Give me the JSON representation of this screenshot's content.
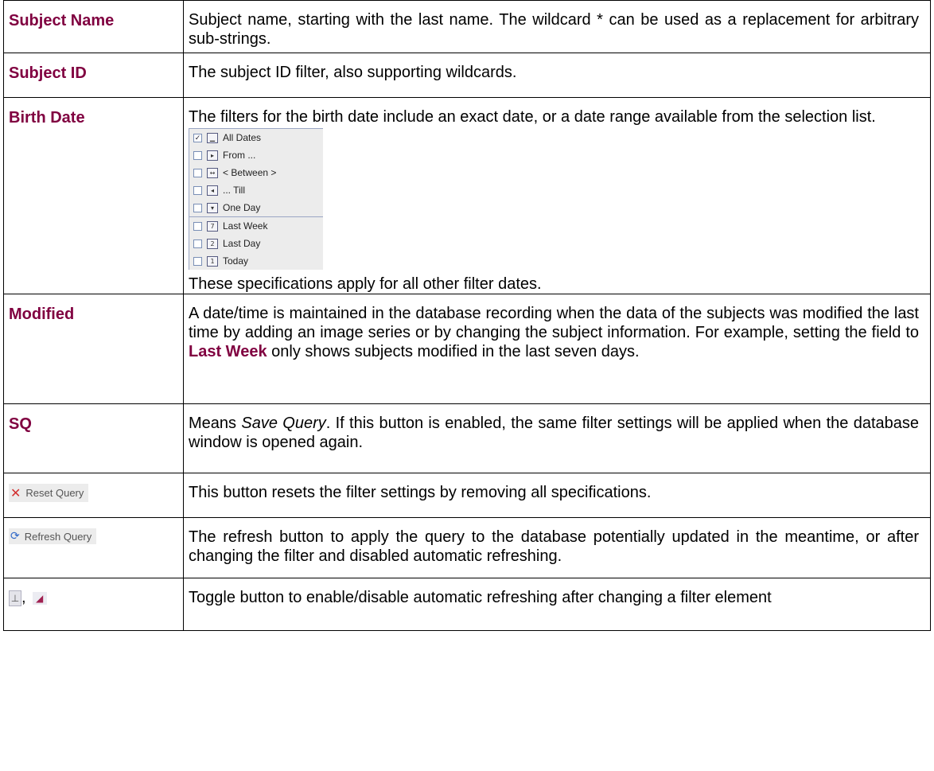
{
  "rows": [
    {
      "term": "Subject Name",
      "desc": "Subject name, starting with the last name. The wildcard * can be used as a replacement for arbitrary sub-strings."
    },
    {
      "term": "Subject ID",
      "desc": "The subject ID filter, also supporting wildcards."
    },
    {
      "term": "Birth Date",
      "desc": "The filters for the birth date include an exact date, or a date range available from the selection list.",
      "desc_after": "These specifications apply for all other filter dates."
    },
    {
      "term": "Modified",
      "desc_before": "A date/time is maintained in the database recording when the data of the subjects was modified the last time by adding an image series or by changing the subject information. For example, setting the field to ",
      "desc_bold": "Last Week",
      "desc_after": " only shows subjects modified in the last seven days."
    },
    {
      "term": "SQ",
      "desc_prefix": "Means ",
      "desc_italic": "Save Query",
      "desc_rest": ". If this button is enabled, the same filter settings will be applied when the database window is opened again."
    },
    {
      "button_label": "Reset Query",
      "desc": "This button resets the filter settings by removing all specifications."
    },
    {
      "button_label": "Refresh Query",
      "desc": "The refresh button to apply the query to the database potentially updated in the meantime, or after changing the filter and disabled automatic refreshing."
    },
    {
      "toggle_separator": ",",
      "desc": "Toggle button to enable/disable automatic refreshing after changing a filter element"
    }
  ],
  "date_options": [
    {
      "label": "All Dates",
      "checked": true,
      "icon": "blank-calendar-icon"
    },
    {
      "label": "From ...",
      "checked": false,
      "icon": "from-calendar-icon"
    },
    {
      "label": "< Between >",
      "checked": false,
      "icon": "between-calendar-icon"
    },
    {
      "label": "... Till",
      "checked": false,
      "icon": "till-calendar-icon"
    },
    {
      "label": "One Day",
      "checked": false,
      "icon": "one-day-calendar-icon"
    },
    {
      "label": "Last Week",
      "checked": false,
      "icon": "seven-calendar-icon",
      "icon_text": "7"
    },
    {
      "label": "Last Day",
      "checked": false,
      "icon": "two-calendar-icon",
      "icon_text": "2"
    },
    {
      "label": "Today",
      "checked": false,
      "icon": "one-calendar-icon",
      "icon_text": "1"
    }
  ]
}
